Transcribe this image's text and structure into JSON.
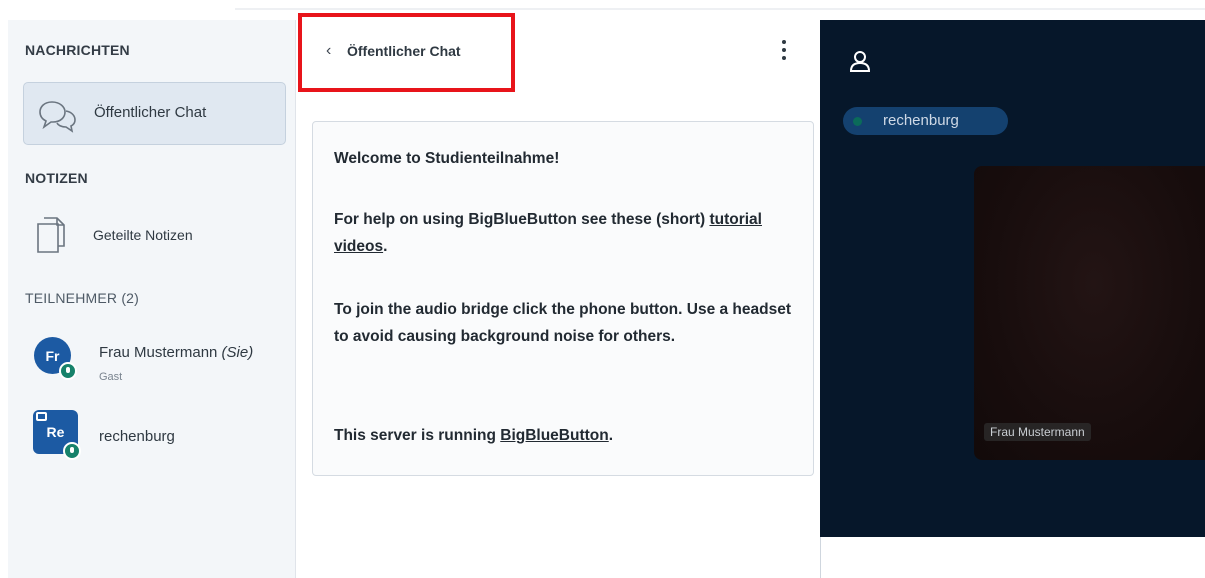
{
  "sidebar": {
    "messages_title": "NACHRICHTEN",
    "public_chat_label": "Öffentlicher Chat",
    "notes_title": "NOTIZEN",
    "shared_notes_label": "Geteilte Notizen",
    "participants_title": "TEILNEHMER (2)",
    "users": [
      {
        "initials": "Fr",
        "name": "Frau Mustermann",
        "self_tag": "(Sie)",
        "role": "Gast"
      },
      {
        "initials": "Re",
        "name": "rechenburg"
      }
    ]
  },
  "chat": {
    "back_icon": "chevron-left-icon",
    "title": "Öffentlicher Chat",
    "options_icon": "kebab-icon",
    "welcome": {
      "greeting_prefix": "Welcome to ",
      "room_name": "Studienteilnahme!",
      "help_text": "For help on using BigBlueButton see these (short) ",
      "help_link": "tutorial videos",
      "help_suffix": ".",
      "audio_line": "To join the audio bridge click the phone button. Use a headset to avoid causing background noise for others.",
      "server_prefix": "This server is running ",
      "server_link": "BigBlueButton",
      "server_suffix": "."
    }
  },
  "video": {
    "presenter_icon": "user-icon",
    "talking_user": "rechenburg",
    "camera_user": "Frau Mustermann"
  },
  "colors": {
    "highlight": "#e8141a",
    "video_bg": "#06172a",
    "avatar": "#1c5aa3",
    "badge": "#17826b"
  }
}
